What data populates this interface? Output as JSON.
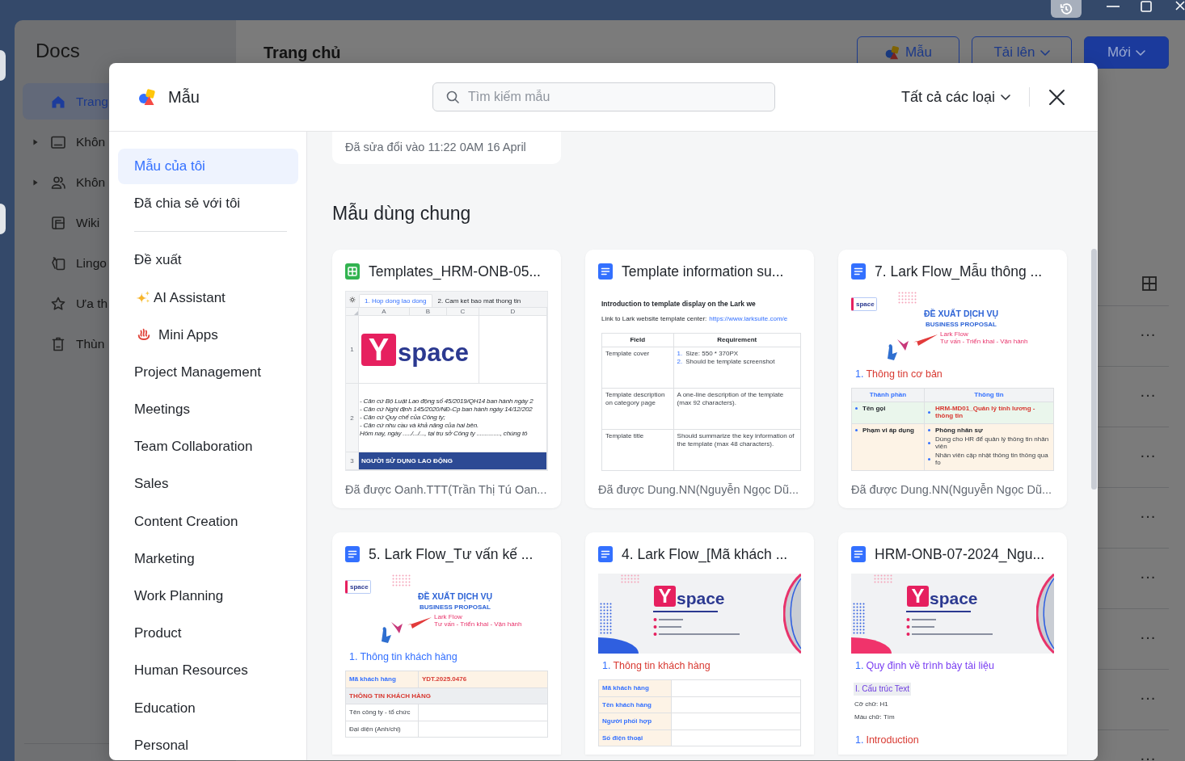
{
  "app": {
    "sidebar": {
      "title": "Docs",
      "items": [
        {
          "label": "Trang",
          "selected": true,
          "expandable": false
        },
        {
          "label": "Khôn",
          "selected": false,
          "expandable": true
        },
        {
          "label": "Khôn",
          "selected": false,
          "expandable": true
        },
        {
          "label": "Wiki",
          "selected": false,
          "expandable": false
        },
        {
          "label": "Lingo",
          "selected": false,
          "expandable": false
        },
        {
          "label": "Ưa th",
          "selected": false,
          "expandable": false
        },
        {
          "label": "Thùn",
          "selected": false,
          "expandable": false
        }
      ]
    },
    "main": {
      "title": "Trang chủ",
      "buttons": [
        {
          "label": "Mẫu",
          "kind": "template"
        },
        {
          "label": "Tải lên",
          "kind": "menu"
        },
        {
          "label": "Mới",
          "kind": "primary"
        }
      ],
      "rows": [
        {
          "more": "···"
        },
        {
          "more": "···"
        },
        {
          "more": "···"
        },
        {
          "more": "···"
        },
        {
          "more": "···"
        },
        {
          "more": "···"
        },
        {
          "more": "···"
        },
        {
          "more": "···"
        }
      ]
    }
  },
  "modal": {
    "title": "Mẫu",
    "search": {
      "placeholder": "Tìm kiếm mẫu"
    },
    "filter": "Tất cả các loại",
    "nav": {
      "mine": [
        {
          "label": "Mẫu của tôi",
          "selected": true
        },
        {
          "label": "Đã chia sẻ với tôi",
          "selected": false
        }
      ],
      "categories": [
        {
          "label": "Đề xuất",
          "selected": false
        },
        {
          "label": "AI Assistant",
          "selected": false
        },
        {
          "label": "Mini Apps",
          "selected": false
        },
        {
          "label": "Project Management",
          "selected": false
        },
        {
          "label": "Meetings",
          "selected": false
        },
        {
          "label": "Team Collaboration",
          "selected": false
        },
        {
          "label": "Sales",
          "selected": false
        },
        {
          "label": "Content Creation",
          "selected": false
        },
        {
          "label": "Marketing",
          "selected": false
        },
        {
          "label": "Work Planning",
          "selected": false
        },
        {
          "label": "Product",
          "selected": false
        },
        {
          "label": "Human Resources",
          "selected": false
        },
        {
          "label": "Education",
          "selected": false
        },
        {
          "label": "Personal",
          "selected": false
        }
      ]
    },
    "content": {
      "recent": "Đã sửa đổi vào 11:22 0AM 16 April",
      "section_title": "Mẫu dùng chung",
      "cards": [
        {
          "kind": "sheet",
          "title": "Templates_HRM-ONB-05...",
          "footer": "Đã được Oanh.TTT(Trần Thị Tú Oan...",
          "preview": {
            "tabs": [
              {
                "label": "1. Hop dong lao dong",
                "selected": true
              },
              {
                "label": "2. Cam ket bao mat thong tin",
                "selected": false
              }
            ],
            "columns": [
              "A",
              "B",
              "C",
              "D"
            ],
            "rows": [
              {
                "number": "1",
                "kind": "logo",
                "logo": {
                  "mark": "Y",
                  "text": "space"
                }
              },
              {
                "number": "2",
                "kind": "text",
                "lines": [
                  "- Căn cứ Bộ Luật Lao động số 45/2019/QH14 ban hành ngày 2",
                  "- Căn cứ Nghị định 145/2020/NĐ-Cp ban hành ngày 14/12/202",
                  "- Căn cứ Quy chế của Công ty;",
                  "- Căn cứ nhu cầu và khả năng của hai bên.",
                  "Hôm nay, ngày ...../.../..., tại trụ sở Công ty .............., chúng tô"
                ]
              },
              {
                "number": "3",
                "kind": "band",
                "text": "NGƯỜI SỬ DỤNG LAO ĐỘNG"
              }
            ]
          }
        },
        {
          "kind": "doc",
          "title": "Template information su...",
          "footer": "Đã được Dung.NN(Nguyễn Ngọc Dũ...",
          "preview": {
            "blocks": [
              {
                "kind": "intro",
                "title": "Introduction to template display on the Lark we",
                "link_label": "Link to Lark website template center:",
                "link": "https://www.larksuite.com/e"
              },
              {
                "kind": "table",
                "bulleted": false,
                "rows": [
                  {
                    "kind": "header",
                    "cells": [
                      {
                        "items": [
                          {
                            "text": "Field"
                          }
                        ]
                      },
                      {
                        "items": [
                          {
                            "text": "Requirement"
                          }
                        ]
                      }
                    ]
                  },
                  {
                    "kind": "pair",
                    "cells": [
                      {
                        "items": [
                          {
                            "text": "Template cover",
                            "bold": false
                          }
                        ]
                      },
                      {
                        "items": [
                          {
                            "number": "1.",
                            "text": "Size: 550 * 370PX",
                            "bold": false
                          },
                          {
                            "number": "2.",
                            "text": "Should be template screenshot",
                            "bold": false
                          }
                        ]
                      }
                    ]
                  },
                  {
                    "kind": "pair",
                    "cells": [
                      {
                        "items": [
                          {
                            "text": "Template description on category page",
                            "bold": false
                          }
                        ]
                      },
                      {
                        "items": [
                          {
                            "text": "A one-line description of the template (max 92 characters).",
                            "bold": false
                          }
                        ]
                      }
                    ]
                  },
                  {
                    "kind": "pair",
                    "cells": [
                      {
                        "items": [
                          {
                            "text": "Template title",
                            "bold": false
                          }
                        ]
                      },
                      {
                        "items": [
                          {
                            "text": "Should summarize the key information of the template (max 48 characters).",
                            "bold": false
                          }
                        ]
                      }
                    ]
                  }
                ]
              }
            ]
          }
        },
        {
          "kind": "doc",
          "title": "7. Lark Flow_Mẫu thông ...",
          "footer": "Đã được Dung.NN(Nguyễn Ngọc Dũ...",
          "preview": {
            "blocks": [
              {
                "kind": "proposal",
                "badge": "space",
                "title": "ĐỀ XUẤT DỊCH VỤ",
                "subtitle": "BUSINESS PROPOSAL",
                "tagline": "Lark Flow",
                "services": "Tư vấn - Triển khai - Vận hành"
              },
              {
                "kind": "heading",
                "number": "1.",
                "text": "Thông tin cơ bản",
                "color": "#d83931"
              },
              {
                "kind": "table",
                "bulleted": true,
                "rows": [
                  {
                    "kind": "header",
                    "cells": [
                      {
                        "color": "#f2f3f5",
                        "items": [
                          {
                            "text": "Thành phần",
                            "color": "#3370ff"
                          }
                        ]
                      },
                      {
                        "color": "#f2f3f5",
                        "items": [
                          {
                            "text": "Thông tin",
                            "color": "#3370ff"
                          }
                        ]
                      }
                    ]
                  },
                  {
                    "kind": "pair",
                    "cells": [
                      {
                        "color": "#eaf6ec",
                        "items": [
                          {
                            "text": "Tên gọi",
                            "bold": true
                          }
                        ]
                      },
                      {
                        "color": "#eaf6ec",
                        "items": [
                          {
                            "text": "HRM-MD01_Quản lý tính lương - thông tin",
                            "bold": true,
                            "color": "#d83931"
                          }
                        ]
                      }
                    ]
                  },
                  {
                    "kind": "pair",
                    "cells": [
                      {
                        "color": "#fdf3e6",
                        "items": [
                          {
                            "text": "Phạm vi áp dụng",
                            "bold": true
                          }
                        ]
                      },
                      {
                        "color": "#fdf3e6",
                        "items": [
                          {
                            "text": "Phòng nhân sự",
                            "bold": true
                          },
                          {
                            "text": "Dùng cho HR để quản lý thông tin nhân viên",
                            "bold": false
                          },
                          {
                            "text": "Nhân viên cập nhật thông tin thông qua fo",
                            "bold": false
                          }
                        ]
                      }
                    ]
                  }
                ]
              }
            ]
          }
        },
        {
          "kind": "doc",
          "title": "5. Lark Flow_Tư vấn kế ...",
          "preview": {
            "blocks": [
              {
                "kind": "proposal",
                "badge": "space",
                "title": "ĐỀ XUẤT DỊCH VỤ",
                "subtitle": "BUSINESS PROPOSAL",
                "tagline": "Lark Flow",
                "services": "Tư vấn - Triển khai - Vận hành"
              },
              {
                "kind": "heading",
                "number": "1.",
                "text": "Thông tin khách hàng",
                "color": "#3370ff"
              },
              {
                "kind": "table",
                "bulleted": false,
                "rows": [
                  {
                    "kind": "pair",
                    "cells": [
                      {
                        "color": "#fdf3e6",
                        "items": [
                          {
                            "text": "Mã khách hàng",
                            "bold": true,
                            "color": "#3370ff"
                          }
                        ]
                      },
                      {
                        "color": "#fdf3e6",
                        "items": [
                          {
                            "text": "YDT.2025.0476",
                            "bold": true,
                            "color": "#d83931"
                          }
                        ]
                      }
                    ]
                  },
                  {
                    "kind": "span",
                    "cells": [
                      {
                        "color": "#eceef1",
                        "items": [
                          {
                            "text": "THÔNG TIN KHÁCH HÀNG",
                            "bold": true,
                            "color": "#d83931"
                          }
                        ]
                      }
                    ]
                  },
                  {
                    "kind": "pair",
                    "cells": [
                      {
                        "items": [
                          {
                            "text": "Tên công ty - tổ chức",
                            "bold": false
                          }
                        ]
                      }
                    ]
                  },
                  {
                    "kind": "pair",
                    "cells": [
                      {
                        "items": [
                          {
                            "text": "Đại diện (Anh/chị)",
                            "bold": false
                          }
                        ]
                      }
                    ]
                  }
                ]
              }
            ]
          }
        },
        {
          "kind": "doc",
          "title": "4. Lark Flow_[Mã khách ...",
          "preview": {
            "blocks": [
              {
                "kind": "banner",
                "mark": "Y",
                "text": "space",
                "color": "#2f5fe0"
              },
              {
                "kind": "heading",
                "number": "1.",
                "text": "Thông tin khách hàng",
                "color": "#d83931"
              },
              {
                "kind": "table",
                "bulleted": false,
                "rows": [
                  {
                    "kind": "pair",
                    "cells": [
                      {
                        "color": "#fdf3e6",
                        "items": [
                          {
                            "text": "Mã khách hàng",
                            "bold": true,
                            "color": "#3370ff"
                          }
                        ]
                      }
                    ]
                  },
                  {
                    "kind": "pair",
                    "cells": [
                      {
                        "color": "#fdf3e6",
                        "items": [
                          {
                            "text": "Tên khách hàng",
                            "bold": true,
                            "color": "#3370ff"
                          }
                        ]
                      }
                    ]
                  },
                  {
                    "kind": "pair",
                    "cells": [
                      {
                        "color": "#fdf3e6",
                        "items": [
                          {
                            "text": "Người phối hợp",
                            "bold": true,
                            "color": "#3370ff"
                          }
                        ]
                      }
                    ]
                  },
                  {
                    "kind": "pair",
                    "cells": [
                      {
                        "color": "#fdf3e6",
                        "items": [
                          {
                            "text": "Số điện thoại",
                            "bold": true,
                            "color": "#3370ff"
                          }
                        ]
                      }
                    ]
                  }
                ]
              }
            ]
          }
        },
        {
          "kind": "doc",
          "title": "HRM-ONB-07-2024_Ngu...",
          "preview": {
            "blocks": [
              {
                "kind": "banner",
                "mark": "Y",
                "text": "space",
                "color": "#f0336b"
              },
              {
                "kind": "heading",
                "number": "1.",
                "text": "Quy định về trình bày tài liệu",
                "color": "#7a3ff2"
              },
              {
                "kind": "subheading",
                "text": "I. Cấu trúc Text"
              },
              {
                "kind": "note",
                "text": "Cỡ chữ: H1"
              },
              {
                "kind": "note",
                "text": "Màu chữ: Tím"
              },
              {
                "kind": "heading",
                "number": "1.",
                "text": "Introduction",
                "color": "#d83931"
              }
            ]
          }
        }
      ]
    }
  }
}
